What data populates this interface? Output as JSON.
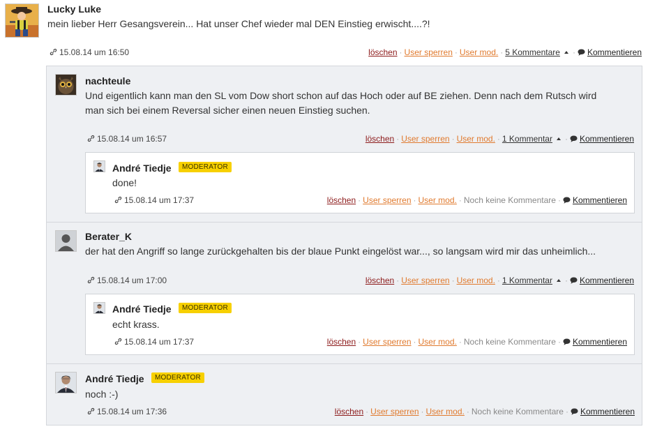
{
  "top": {
    "author": "Lucky Luke",
    "text": "mein lieber Herr Gesangsverein... Hat unser Chef wieder mal DEN Einstieg erwischt....?!",
    "timestamp": "15.08.14 um 16:50",
    "actions": {
      "delete": "löschen",
      "block": "User sperren",
      "mod": "User mod.",
      "comments": "5 Kommentare",
      "reply": "Kommentieren"
    }
  },
  "replies": [
    {
      "author": "nachteule",
      "text_line1": "Und eigentlich kann man den SL vom Dow short schon auf das Hoch oder auf BE ziehen. Denn nach dem Rutsch wird",
      "text_line2": "man sich bei einem Reversal sicher einen neuen Einstieg suchen.",
      "timestamp": "15.08.14 um 16:57",
      "actions": {
        "delete": "löschen",
        "block": "User sperren",
        "mod": "User mod.",
        "comments": "1 Kommentar",
        "reply": "Kommentieren"
      },
      "sub": {
        "author": "André Tiedje",
        "badge": "MODERATOR",
        "text": "done!",
        "timestamp": "15.08.14 um 17:37",
        "actions": {
          "delete": "löschen",
          "block": "User sperren",
          "mod": "User mod.",
          "none": "Noch keine Kommentare",
          "reply": "Kommentieren"
        }
      }
    },
    {
      "author": "Berater_K",
      "text": "der hat den Angriff so lange zurückgehalten bis der blaue Punkt eingelöst war..., so langsam wird mir das unheimlich...",
      "timestamp": "15.08.14 um 17:00",
      "actions": {
        "delete": "löschen",
        "block": "User sperren",
        "mod": "User mod.",
        "comments": "1 Kommentar",
        "reply": "Kommentieren"
      },
      "sub": {
        "author": "André Tiedje",
        "badge": "MODERATOR",
        "text": "echt krass.",
        "timestamp": "15.08.14 um 17:37",
        "actions": {
          "delete": "löschen",
          "block": "User sperren",
          "mod": "User mod.",
          "none": "Noch keine Kommentare",
          "reply": "Kommentieren"
        }
      }
    },
    {
      "author": "André Tiedje",
      "badge": "MODERATOR",
      "text": "noch :-)",
      "timestamp": "15.08.14 um 17:36",
      "actions": {
        "delete": "löschen",
        "block": "User sperren",
        "mod": "User mod.",
        "none": "Noch keine Kommentare",
        "reply": "Kommentieren"
      }
    }
  ],
  "icons": {
    "permalink": "link-icon",
    "reply": "speech-bubble-icon",
    "collapse": "arrow-up-icon"
  },
  "colors": {
    "delete": "#8c1a1a",
    "mod": "#e07a2e",
    "badge": "#f7d000",
    "thread_bg": "#eef0f3"
  }
}
